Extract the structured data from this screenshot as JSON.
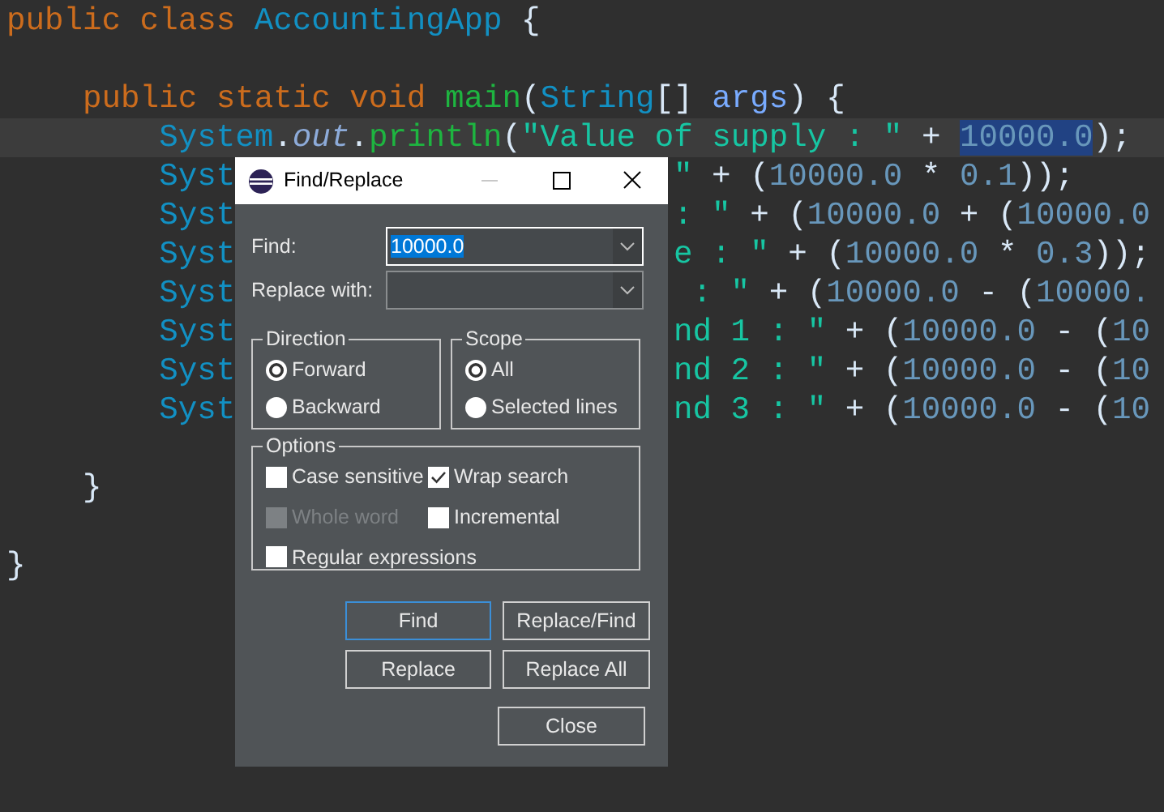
{
  "editor": {
    "lines": [
      {
        "kind": "code",
        "tokens": [
          {
            "kind": "keyword",
            "text": "public class "
          },
          {
            "kind": "type",
            "text": "AccountingApp"
          },
          {
            "kind": "plain",
            "text": " {"
          }
        ]
      },
      {
        "kind": "blank"
      },
      {
        "kind": "code",
        "tokens": [
          {
            "kind": "keyword",
            "text": "    public static void "
          },
          {
            "kind": "method",
            "text": "main"
          },
          {
            "kind": "plain",
            "text": "("
          },
          {
            "kind": "type",
            "text": "String"
          },
          {
            "kind": "plain",
            "text": "[] "
          },
          {
            "kind": "param",
            "text": "args"
          },
          {
            "kind": "plain",
            "text": ") {"
          }
        ]
      },
      {
        "kind": "code",
        "current": true,
        "tokens": [
          {
            "kind": "type",
            "text": "        System"
          },
          {
            "kind": "plain",
            "text": "."
          },
          {
            "kind": "field",
            "text": "out"
          },
          {
            "kind": "plain",
            "text": "."
          },
          {
            "kind": "method",
            "text": "println"
          },
          {
            "kind": "plain",
            "text": "("
          },
          {
            "kind": "string",
            "text": "\"Value of supply : \""
          },
          {
            "kind": "plain",
            "text": " + "
          },
          {
            "kind": "number",
            "text": "10000.0",
            "selected": true
          },
          {
            "kind": "plain",
            "text": ");"
          }
        ]
      },
      {
        "kind": "split",
        "left": [
          {
            "kind": "type",
            "text": "Syst"
          }
        ],
        "right": [
          {
            "kind": "string",
            "text": "\""
          },
          {
            "kind": "plain",
            "text": " + ("
          },
          {
            "kind": "number",
            "text": "10000.0"
          },
          {
            "kind": "plain",
            "text": " * "
          },
          {
            "kind": "number",
            "text": "0.1"
          },
          {
            "kind": "plain",
            "text": "));"
          }
        ]
      },
      {
        "kind": "split",
        "left": [
          {
            "kind": "type",
            "text": "Syst"
          }
        ],
        "right": [
          {
            "kind": "string",
            "text": ": \""
          },
          {
            "kind": "plain",
            "text": " + ("
          },
          {
            "kind": "number",
            "text": "10000.0"
          },
          {
            "kind": "plain",
            "text": " + ("
          },
          {
            "kind": "number",
            "text": "10000.0"
          }
        ]
      },
      {
        "kind": "split",
        "left": [
          {
            "kind": "type",
            "text": "Syst"
          }
        ],
        "right": [
          {
            "kind": "string",
            "text": "e : \""
          },
          {
            "kind": "plain",
            "text": " + ("
          },
          {
            "kind": "number",
            "text": "10000.0"
          },
          {
            "kind": "plain",
            "text": " * "
          },
          {
            "kind": "number",
            "text": "0.3"
          },
          {
            "kind": "plain",
            "text": "));"
          }
        ]
      },
      {
        "kind": "split",
        "left": [
          {
            "kind": "type",
            "text": "Syst"
          }
        ],
        "right": [
          {
            "kind": "string",
            "text": " : \""
          },
          {
            "kind": "plain",
            "text": " + ("
          },
          {
            "kind": "number",
            "text": "10000.0"
          },
          {
            "kind": "plain",
            "text": " - ("
          },
          {
            "kind": "number",
            "text": "10000."
          }
        ]
      },
      {
        "kind": "split",
        "left": [
          {
            "kind": "type",
            "text": "Syst"
          }
        ],
        "right": [
          {
            "kind": "string",
            "text": "nd 1 : \""
          },
          {
            "kind": "plain",
            "text": " + ("
          },
          {
            "kind": "number",
            "text": "10000.0"
          },
          {
            "kind": "plain",
            "text": " - ("
          },
          {
            "kind": "number",
            "text": "10"
          }
        ]
      },
      {
        "kind": "split",
        "left": [
          {
            "kind": "type",
            "text": "Syst"
          }
        ],
        "right": [
          {
            "kind": "string",
            "text": "nd 2 : \""
          },
          {
            "kind": "plain",
            "text": " + ("
          },
          {
            "kind": "number",
            "text": "10000.0"
          },
          {
            "kind": "plain",
            "text": " - ("
          },
          {
            "kind": "number",
            "text": "10"
          }
        ]
      },
      {
        "kind": "split",
        "left": [
          {
            "kind": "type",
            "text": "Syst"
          }
        ],
        "right": [
          {
            "kind": "string",
            "text": "nd 3 : \""
          },
          {
            "kind": "plain",
            "text": " + ("
          },
          {
            "kind": "number",
            "text": "10000.0"
          },
          {
            "kind": "plain",
            "text": " - ("
          },
          {
            "kind": "number",
            "text": "10"
          }
        ]
      },
      {
        "kind": "blank"
      },
      {
        "kind": "code",
        "tokens": [
          {
            "kind": "plain",
            "text": "    }"
          }
        ]
      },
      {
        "kind": "blank"
      },
      {
        "kind": "code",
        "tokens": [
          {
            "kind": "plain",
            "text": "}"
          }
        ]
      }
    ]
  },
  "dialog": {
    "title": "Find/Replace",
    "find": {
      "label": "Find:",
      "value": "10000.0",
      "focused": true
    },
    "replace": {
      "label": "Replace with:",
      "focused": false
    },
    "direction": {
      "title": "Direction",
      "options": [
        {
          "label": "Forward",
          "selected": true
        },
        {
          "label": "Backward",
          "selected": false
        }
      ]
    },
    "scope": {
      "title": "Scope",
      "options": [
        {
          "label": "All",
          "selected": true
        },
        {
          "label": "Selected lines",
          "selected": false
        }
      ]
    },
    "options": {
      "title": "Options",
      "items": [
        {
          "label": "Case sensitive",
          "checked": false,
          "disabled": false
        },
        {
          "label": "Wrap search",
          "checked": true,
          "disabled": false
        },
        {
          "label": "Whole word",
          "checked": false,
          "disabled": true
        },
        {
          "label": "Incremental",
          "checked": false,
          "disabled": false
        },
        {
          "label": "Regular expressions",
          "checked": false,
          "disabled": false
        }
      ]
    },
    "buttons": [
      {
        "label": "Find",
        "default": true
      },
      {
        "label": "Replace/Find",
        "default": false
      },
      {
        "label": "Replace",
        "default": false
      },
      {
        "label": "Replace All",
        "default": false
      }
    ],
    "close": {
      "label": "Close"
    }
  }
}
